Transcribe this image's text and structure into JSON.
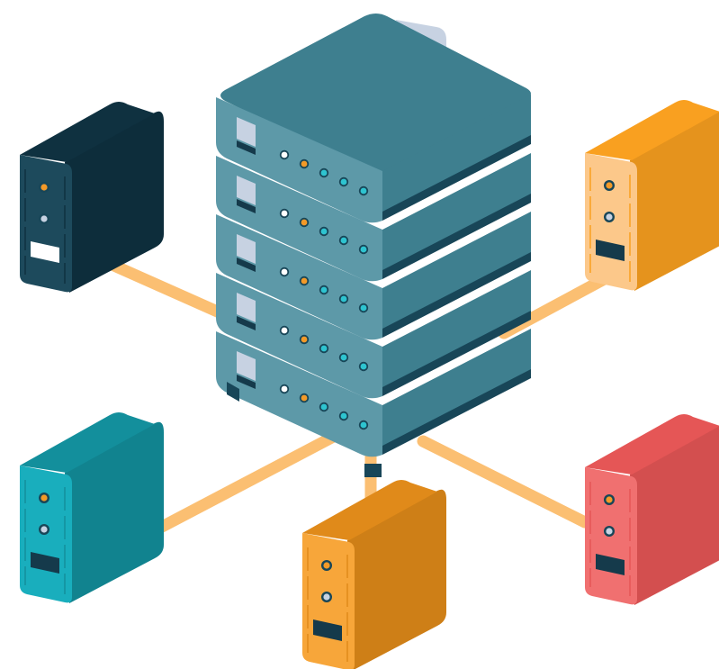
{
  "colors": {
    "background": "#ffffff",
    "cable": "#fbbf72",
    "server_top": "#3e7f8f",
    "server_front": "#5d99a8",
    "server_dark": "#184658",
    "server_screen": "#c7d2e2",
    "server_screen_dark": "#153a4b",
    "led_orange": "#f39a28",
    "led_cyan": "#2ec4d0",
    "led_white": "#ffffff",
    "tower_navy": "#0f3140",
    "tower_orange_right": "#f9a020",
    "tower_teal": "#138f9c",
    "tower_orange_bottom": "#e08a1a",
    "tower_red": "#e55656"
  },
  "icons": {
    "server_rack": "server-rack-icon",
    "tower": "desktop-tower-icon"
  },
  "server": {
    "units": 5,
    "leds_per_unit": [
      "led_white",
      "led_orange",
      "led_cyan",
      "led_cyan",
      "led_cyan"
    ]
  },
  "towers": [
    {
      "id": "top-left",
      "color": "tower_navy",
      "light": "#1d4a5c",
      "badge": "white-bar"
    },
    {
      "id": "top-right",
      "color": "tower_orange_right",
      "light": "#fcc88a",
      "badge": "dark-bar"
    },
    {
      "id": "bottom-left",
      "color": "tower_teal",
      "light": "#19aebd",
      "badge": "dark-bar"
    },
    {
      "id": "bottom-center",
      "color": "tower_orange_bottom",
      "light": "#f7a63a",
      "badge": "dark-bar"
    },
    {
      "id": "bottom-right",
      "color": "tower_red",
      "light": "#f07070",
      "badge": "dark-bar"
    }
  ]
}
